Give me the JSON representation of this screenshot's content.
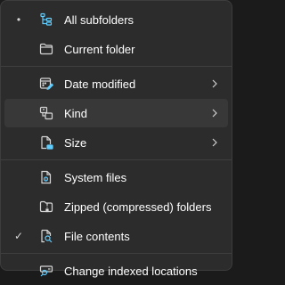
{
  "menu": {
    "items": [
      {
        "id": "all-subfolders",
        "label": "All subfolders",
        "mark": "•",
        "icon": "folder-tree-icon"
      },
      {
        "id": "current-folder",
        "label": "Current folder",
        "mark": "",
        "icon": "folder-icon"
      },
      {
        "id": "date-modified",
        "label": "Date modified",
        "mark": "",
        "icon": "calendar-edit-icon",
        "submenu": true
      },
      {
        "id": "kind",
        "label": "Kind",
        "mark": "",
        "icon": "shapes-icon",
        "submenu": true,
        "hover": true
      },
      {
        "id": "size",
        "label": "Size",
        "mark": "",
        "icon": "document-size-icon",
        "submenu": true
      },
      {
        "id": "system-files",
        "label": "System files",
        "mark": "",
        "icon": "document-settings-icon"
      },
      {
        "id": "zipped-folders",
        "label": "Zipped (compressed) folders",
        "mark": "",
        "icon": "folder-zip-icon"
      },
      {
        "id": "file-contents",
        "label": "File contents",
        "mark": "✓",
        "icon": "document-search-icon"
      },
      {
        "id": "change-indexed",
        "label": "Change indexed locations",
        "mark": "",
        "icon": "search-database-icon"
      }
    ]
  },
  "colors": {
    "background": "#2c2c2c",
    "hover": "#383838",
    "accent": "#60cdff",
    "text": "#ffffff"
  }
}
